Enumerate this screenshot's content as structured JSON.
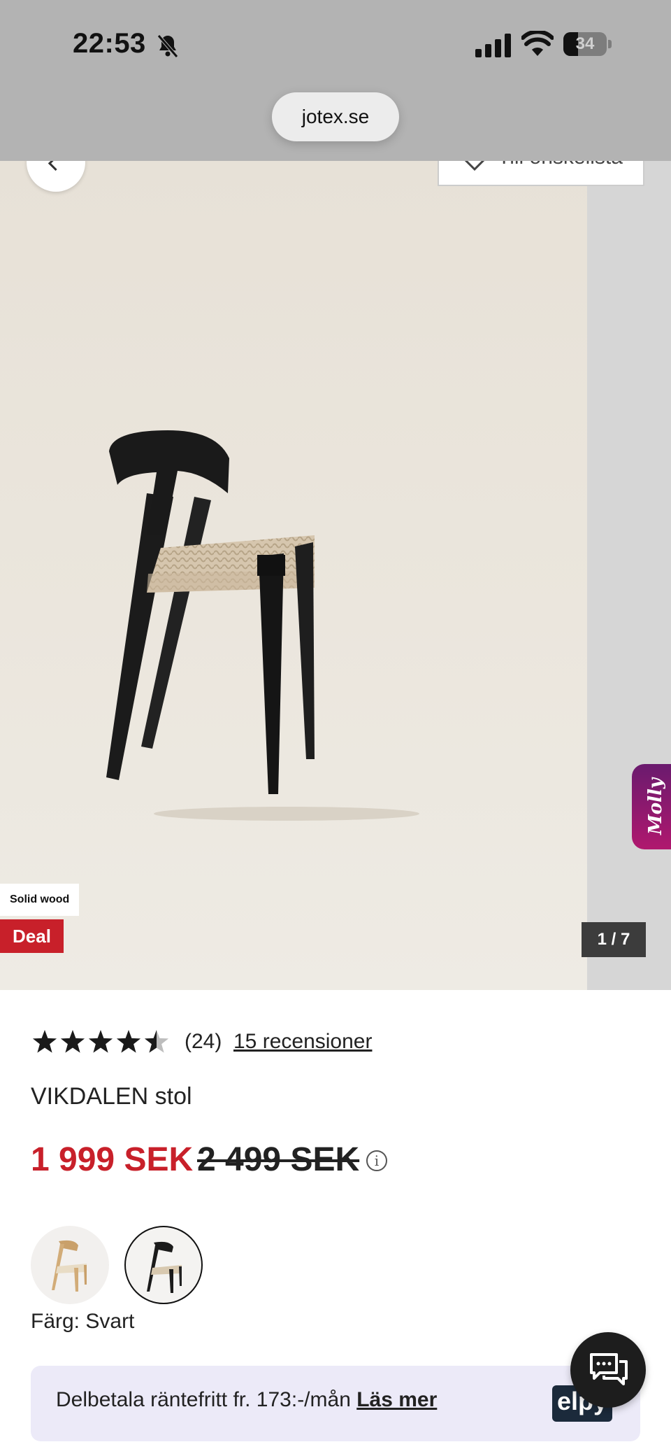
{
  "status_bar": {
    "time": "22:53",
    "battery_percent": "34",
    "battery_level": 0.34,
    "url": "jotex.se"
  },
  "hero": {
    "favorite_label": "Till önskelista",
    "badges": {
      "material": "Solid wood",
      "deal": "Deal"
    },
    "image_counter": "1 / 7",
    "assistant_label": "Molly"
  },
  "product": {
    "rating_value": 4.5,
    "review_count": "(24)",
    "reviews_link": "15 recensioner",
    "name": "VIKDALEN stol",
    "price": "1 999 SEK",
    "old_price": "2 499 SEK",
    "info_symbol": "i",
    "color_label": "Färg:",
    "color_value": "Svart",
    "swatches": [
      {
        "name": "Natur",
        "color": "#d8b98a",
        "selected": false
      },
      {
        "name": "Svart",
        "color": "#1b1b1b",
        "selected": true
      }
    ]
  },
  "payment": {
    "text": "Delbetala räntefritt fr. 173:-/mån",
    "link": "Läs mer",
    "logo_text": "elpy"
  },
  "colors": {
    "accent_red": "#c8202a",
    "banner_bg": "#eceaf8",
    "molly_gradient": "#b0186e"
  }
}
